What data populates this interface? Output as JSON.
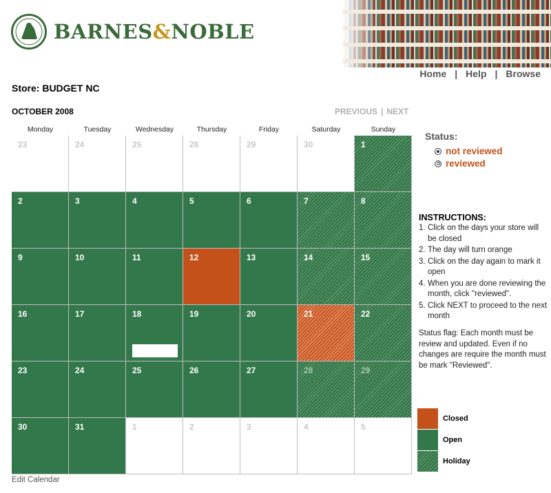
{
  "brand": {
    "name_part1": "BARNES",
    "amp": "&",
    "name_part2": "NOBLE"
  },
  "nav": {
    "home": "Home",
    "help": "Help",
    "browse": "Browse",
    "separator": "|"
  },
  "store": {
    "label": "Store: BUDGET NC"
  },
  "calendar": {
    "month_label": "OCTOBER 2008",
    "previous": "PREVIOUS",
    "next": "NEXT",
    "pager_separator": "|",
    "weekdays": [
      "Monday",
      "Tuesday",
      "Wednesday",
      "Thursday",
      "Friday",
      "Saturday",
      "Sunday"
    ],
    "weeks": [
      [
        {
          "d": "23",
          "s": "empty"
        },
        {
          "d": "24",
          "s": "empty"
        },
        {
          "d": "25",
          "s": "empty"
        },
        {
          "d": "28",
          "s": "empty"
        },
        {
          "d": "29",
          "s": "empty"
        },
        {
          "d": "30",
          "s": "empty"
        },
        {
          "d": "1",
          "s": "holiday"
        }
      ],
      [
        {
          "d": "2",
          "s": "open"
        },
        {
          "d": "3",
          "s": "open"
        },
        {
          "d": "4",
          "s": "open"
        },
        {
          "d": "5",
          "s": "open"
        },
        {
          "d": "6",
          "s": "open"
        },
        {
          "d": "7",
          "s": "holiday"
        },
        {
          "d": "8",
          "s": "holiday"
        }
      ],
      [
        {
          "d": "9",
          "s": "open"
        },
        {
          "d": "10",
          "s": "open"
        },
        {
          "d": "11",
          "s": "open"
        },
        {
          "d": "12",
          "s": "closed"
        },
        {
          "d": "13",
          "s": "open"
        },
        {
          "d": "14",
          "s": "holiday"
        },
        {
          "d": "15",
          "s": "holiday"
        }
      ],
      [
        {
          "d": "16",
          "s": "open"
        },
        {
          "d": "17",
          "s": "open"
        },
        {
          "d": "18",
          "s": "open"
        },
        {
          "d": "19",
          "s": "open"
        },
        {
          "d": "20",
          "s": "open"
        },
        {
          "d": "21",
          "s": "holiday-closed"
        },
        {
          "d": "22",
          "s": "holiday"
        }
      ],
      [
        {
          "d": "23",
          "s": "open"
        },
        {
          "d": "24",
          "s": "open"
        },
        {
          "d": "25",
          "s": "open"
        },
        {
          "d": "26",
          "s": "open"
        },
        {
          "d": "27",
          "s": "open"
        },
        {
          "d": "28",
          "s": "holiday-dim"
        },
        {
          "d": "29",
          "s": "holiday-dim"
        }
      ],
      [
        {
          "d": "30",
          "s": "open"
        },
        {
          "d": "31",
          "s": "open"
        },
        {
          "d": "1",
          "s": "empty"
        },
        {
          "d": "2",
          "s": "empty"
        },
        {
          "d": "3",
          "s": "empty"
        },
        {
          "d": "4",
          "s": "empty"
        },
        {
          "d": "5",
          "s": "empty"
        }
      ]
    ],
    "edit_link": "Edit Calendar"
  },
  "status": {
    "title": "Status:",
    "options": [
      {
        "label": "not reviewed",
        "selected": true
      },
      {
        "label": "reviewed",
        "selected": false
      }
    ]
  },
  "instructions": {
    "title": "INSTRUCTIONS:",
    "steps": [
      {
        "n": "1.",
        "text": "Click on the days your store will be closed"
      },
      {
        "n": "2.",
        "text": "The day will turn orange"
      },
      {
        "n": "3.",
        "text": "Click on the day again to mark it open"
      },
      {
        "n": "4.",
        "text": "When you are done reviewing the month, click \"reviewed\"."
      },
      {
        "n": "5.",
        "text": "Click NEXT to proceed to the next month"
      }
    ],
    "flag_note": "Status flag: Each month must be review and updated. Even if no changes are require the month must be mark \"Reviewed\"."
  },
  "legend": [
    {
      "label": "Closed",
      "kind": "closed"
    },
    {
      "label": "Open",
      "kind": "open"
    },
    {
      "label": "Holiday",
      "kind": "holiday"
    }
  ],
  "colors": {
    "open": "#33784b",
    "closed": "#c5511a",
    "brand_green": "#3a6b3a",
    "brand_gold": "#c8961e"
  }
}
